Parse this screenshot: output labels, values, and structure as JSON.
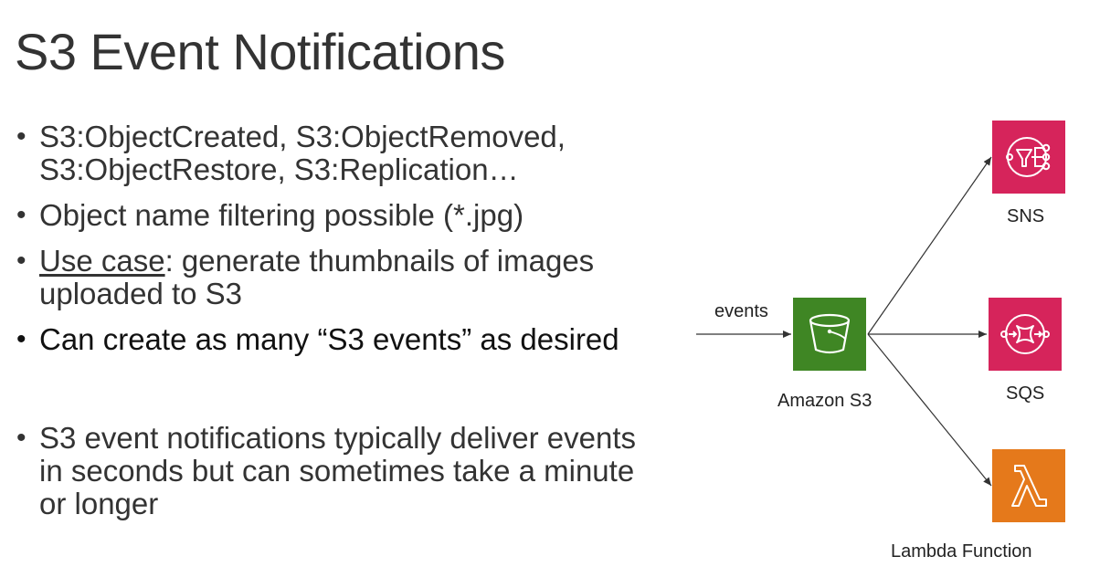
{
  "slide": {
    "title": "S3 Event Notifications",
    "bullets": [
      {
        "line1": "S3:ObjectCreated, S3:ObjectRemoved,",
        "line2": "S3:ObjectRestore, S3:Replication…"
      },
      {
        "text": "Object name filtering possible (*.jpg)"
      },
      {
        "underline": "Use case",
        "rest": ": generate thumbnails of images",
        "line2": "uploaded to S3"
      },
      {
        "text": "Can create as many “S3 events” as desired"
      },
      {
        "line1": "S3 event notifications typically deliver events",
        "line2": "in seconds but can sometimes take a minute",
        "line3": "or longer"
      }
    ]
  },
  "diagram": {
    "input_label": "events",
    "source": {
      "label": "Amazon S3",
      "icon": "s3-bucket-icon",
      "color": "#3F8624"
    },
    "targets": [
      {
        "label": "SNS",
        "icon": "sns-icon",
        "color": "#D6245B"
      },
      {
        "label": "SQS",
        "icon": "sqs-icon",
        "color": "#D6245B"
      },
      {
        "label": "Lambda Function",
        "icon": "lambda-icon",
        "color": "#E5791B"
      }
    ]
  }
}
